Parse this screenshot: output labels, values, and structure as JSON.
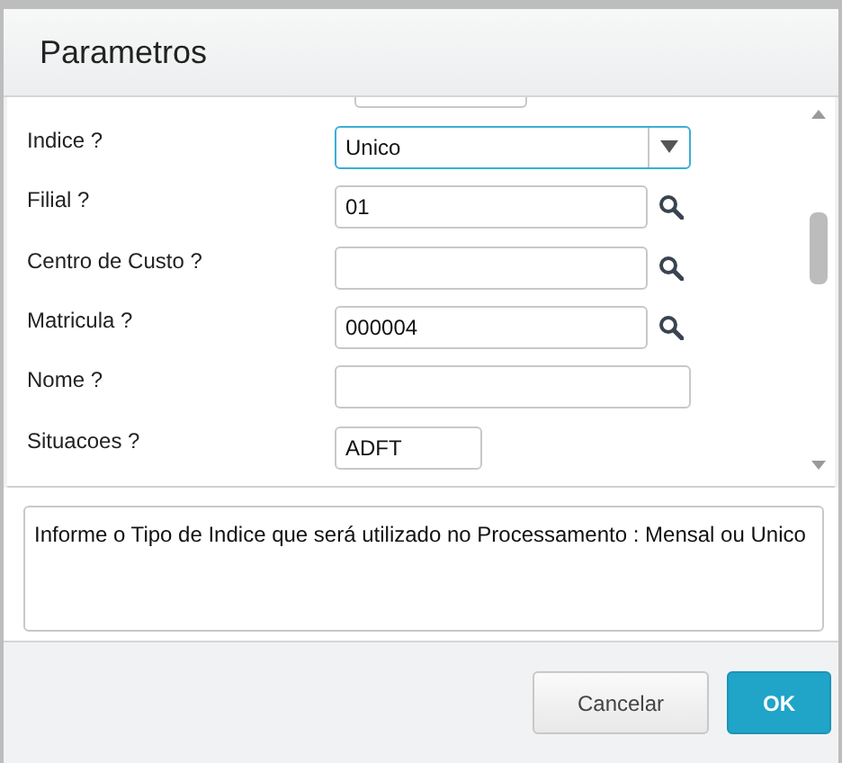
{
  "window": {
    "title": "Parametros"
  },
  "fields": [
    {
      "label": "Indice ?",
      "kind": "select",
      "value": "Unico",
      "focused": true
    },
    {
      "label": "Filial ?",
      "kind": "lookup",
      "value": "01",
      "focused": false
    },
    {
      "label": "Centro de Custo ?",
      "kind": "lookup",
      "focused": false
    },
    {
      "label": "Matricula ?",
      "kind": "lookup",
      "value": "000004",
      "focused": false
    },
    {
      "label": "Nome ?",
      "kind": "text",
      "focused": false
    },
    {
      "label": "Situacoes ?",
      "kind": "short",
      "value": "ADFT",
      "focused": false
    }
  ],
  "help": "Informe o Tipo de Indice que será utilizado no Processamento : Mensal ou Unico",
  "buttons": [
    {
      "label": "Cancelar",
      "kind": "secondary"
    },
    {
      "label": "OK",
      "kind": "primary"
    }
  ]
}
